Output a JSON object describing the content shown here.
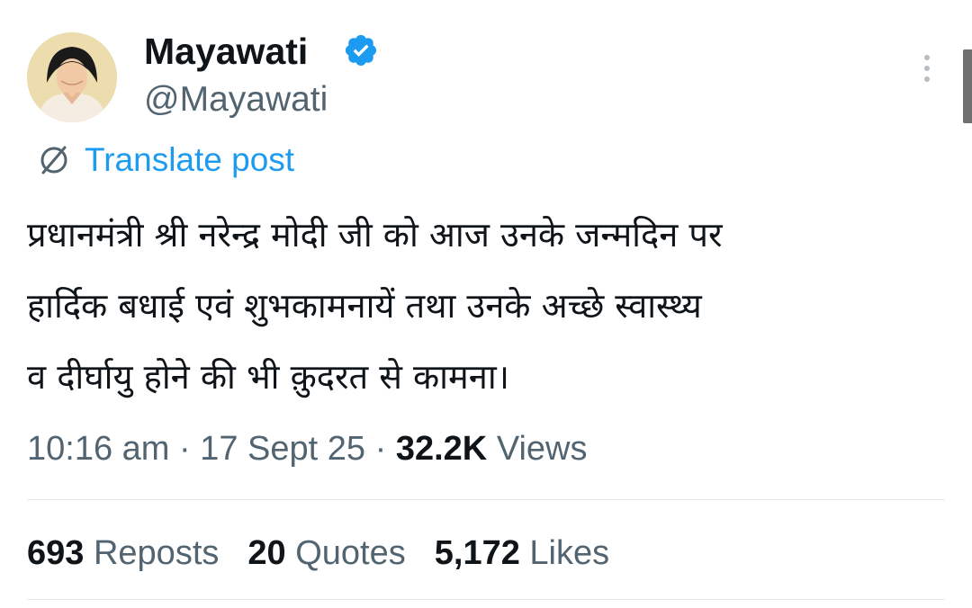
{
  "author": {
    "display_name": "Mayawati",
    "handle": "@Mayawati",
    "verified": true
  },
  "translate": {
    "label": "Translate post"
  },
  "tweet": {
    "lines": [
      "प्रधानमंत्री श्री नरेन्द्र मोदी जी को आज उनके जन्मदिन पर",
      "हार्दिक बधाई एवं शुभकामनायें तथा उनके अच्छे स्वास्थ्य",
      "व दीर्घायु होने की भी क़ुदरत से कामना।"
    ]
  },
  "meta": {
    "time": "10:16 am",
    "separator": "·",
    "date": "17 Sept 25",
    "views_count": "32.2K",
    "views_label": "Views"
  },
  "stats": {
    "reposts_count": "693",
    "reposts_label": "Reposts",
    "quotes_count": "20",
    "quotes_label": "Quotes",
    "likes_count": "5,172",
    "likes_label": "Likes"
  },
  "colors": {
    "accent": "#1d9bf0",
    "secondary_text": "#536471",
    "primary_text": "#0f1419",
    "divider": "#e7e9ea"
  },
  "icons": {
    "verified": "verified-badge-icon",
    "more": "more-vertical-icon",
    "translate": "translate-globe-icon"
  }
}
